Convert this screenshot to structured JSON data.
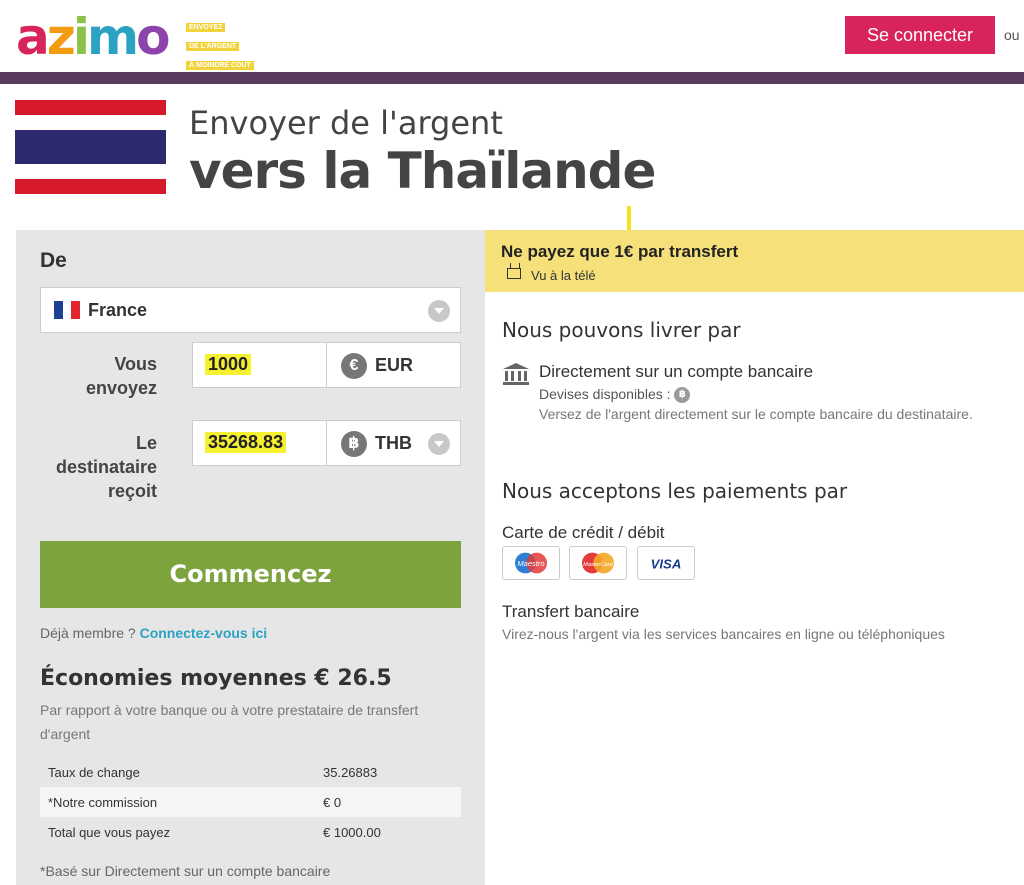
{
  "header": {
    "logo_text": "azimo",
    "tagline": [
      "ENVOYEZ",
      "DE L'ARGENT",
      "À MOINDRE COÛT"
    ],
    "login_button": "Se connecter",
    "or_text": "ou"
  },
  "title": {
    "line1": "Envoyer de l'argent",
    "line2": "vers la Thaïlande"
  },
  "form": {
    "from_label": "De",
    "country": "France",
    "send_label_1": "Vous",
    "send_label_2": "envoyez",
    "send_amount": "1000",
    "send_currency": "EUR",
    "send_currency_icon": "€",
    "receive_label_1": "Le",
    "receive_label_2": "destinataire",
    "receive_label_3": "reçoit",
    "receive_amount": "35268.83",
    "receive_currency": "THB",
    "receive_currency_icon": "฿",
    "start_button": "Commencez",
    "member_text": "Déjà membre ?",
    "member_link": "Connectez-vous ici"
  },
  "savings": {
    "title": "Économies moyennes € 26.5",
    "description": "Par rapport à votre banque ou à votre prestataire de transfert d'argent",
    "rows": [
      {
        "label": "Taux de change",
        "value": "35.26883"
      },
      {
        "label": "*Notre commission",
        "value": "€ 0"
      },
      {
        "label": "Total que vous payez",
        "value": "€ 1000.00"
      }
    ],
    "footnote": "*Basé sur Directement sur un compte bancaire"
  },
  "promo": {
    "title": "Ne payez que 1€ par transfert",
    "subtitle": "Vu à la télé"
  },
  "delivery": {
    "section_title": "Nous pouvons livrer par",
    "method_title": "Directement sur un compte bancaire",
    "currencies_label": "Devises disponibles :",
    "currency_icon": "฿",
    "method_desc": "Versez de l'argent directement sur le compte bancaire du destinataire."
  },
  "payment": {
    "section_title": "Nous acceptons les paiements par",
    "card_title": "Carte de crédit / débit",
    "cards": [
      "Maestro",
      "MasterCard",
      "VISA"
    ],
    "transfer_title": "Transfert bancaire",
    "transfer_desc": "Virez-nous l'argent via les services bancaires en ligne ou téléphoniques"
  },
  "colors": {
    "brand_pink": "#d8245a",
    "header_bar": "#5a3c5e",
    "cta_green": "#7da33f",
    "promo_yellow": "#f5e07a",
    "link_blue": "#2ba2c2"
  }
}
